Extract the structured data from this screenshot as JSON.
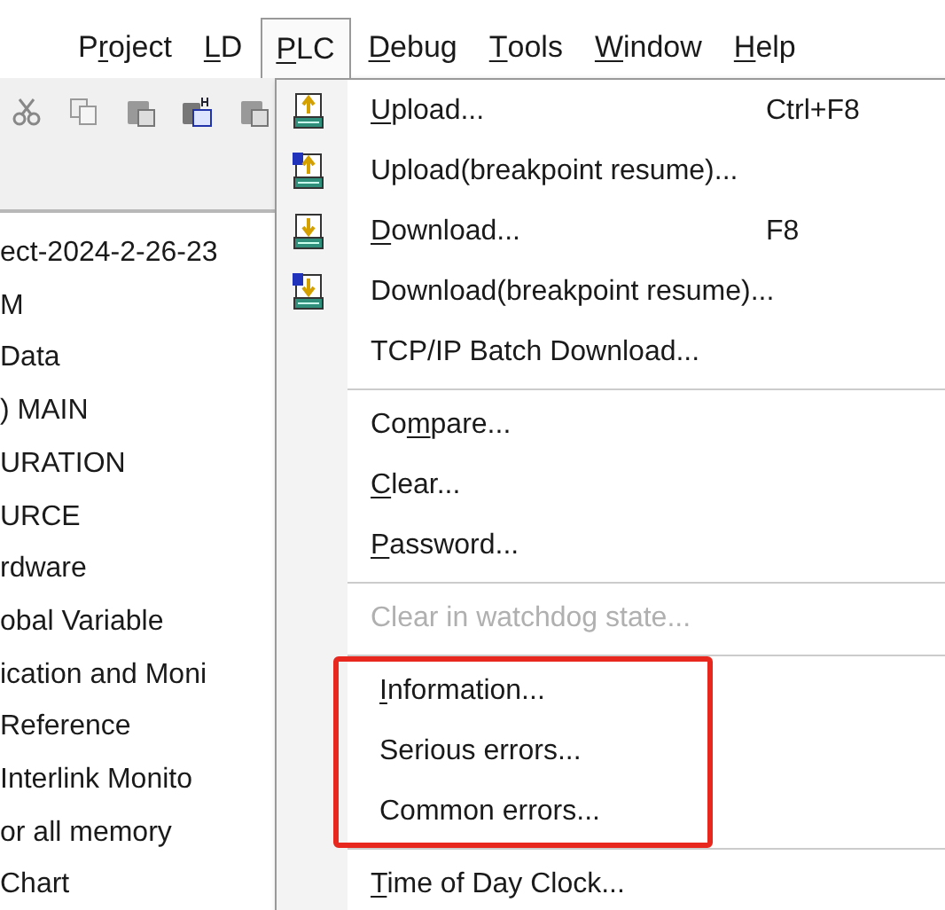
{
  "menubar": [
    {
      "pre": "P",
      "key": "r",
      "post": "oject",
      "selected": false
    },
    {
      "key": "L",
      "post": "D",
      "selected": false
    },
    {
      "key": "P",
      "post": "LC",
      "selected": true
    },
    {
      "key": "D",
      "post": "ebug",
      "selected": false
    },
    {
      "key": "T",
      "post": "ools",
      "selected": false
    },
    {
      "key": "W",
      "post": "indow",
      "selected": false
    },
    {
      "key": "H",
      "post": "elp",
      "selected": false
    }
  ],
  "toolbar": [
    {
      "kind": "cut"
    },
    {
      "kind": "copy"
    },
    {
      "kind": "paste"
    },
    {
      "kind": "paste-special"
    },
    {
      "kind": "paste"
    }
  ],
  "tree": [
    "ect-2024-2-26-23",
    "M",
    "Data",
    ") MAIN",
    "URATION",
    "URCE",
    "rdware",
    "obal Variable",
    "ication and Moni",
    "Reference",
    "Interlink Monito",
    "or all memory",
    "Chart"
  ],
  "menu": {
    "sections": [
      {
        "highlighted": false,
        "items": [
          {
            "key": "U",
            "post": "pload...",
            "shortcut": "Ctrl+F8",
            "kind": "upload",
            "disabled": false
          },
          {
            "pre": "Upload(breakpoint resume)...",
            "kind": "upload-resume",
            "disabled": false
          },
          {
            "key": "D",
            "post": "ownload...",
            "shortcut": "F8",
            "kind": "download",
            "disabled": false
          },
          {
            "pre": "Download(breakpoint resume)...",
            "kind": "download-resume",
            "disabled": false
          },
          {
            "pre": "TCP/IP Batch Download...",
            "kind": "plain",
            "disabled": false
          }
        ]
      },
      {
        "highlighted": false,
        "items": [
          {
            "pre": "Co",
            "key": "m",
            "post": "pare...",
            "kind": "plain",
            "disabled": false
          },
          {
            "key": "C",
            "post": "lear...",
            "kind": "plain",
            "disabled": false
          },
          {
            "key": "P",
            "post": "assword...",
            "kind": "plain",
            "disabled": false
          }
        ]
      },
      {
        "highlighted": false,
        "items": [
          {
            "pre": "Clear in watchdog state...",
            "kind": "plain",
            "disabled": true
          }
        ]
      },
      {
        "highlighted": true,
        "items": [
          {
            "key": "I",
            "post": "nformation...",
            "kind": "plain",
            "disabled": false
          },
          {
            "pre": "Serious errors...",
            "kind": "plain",
            "disabled": false
          },
          {
            "pre": "Common errors...",
            "kind": "plain",
            "disabled": false
          }
        ]
      },
      {
        "highlighted": false,
        "items": [
          {
            "key": "T",
            "post": "ime of Day Clock...",
            "kind": "plain",
            "disabled": false
          }
        ]
      }
    ]
  }
}
